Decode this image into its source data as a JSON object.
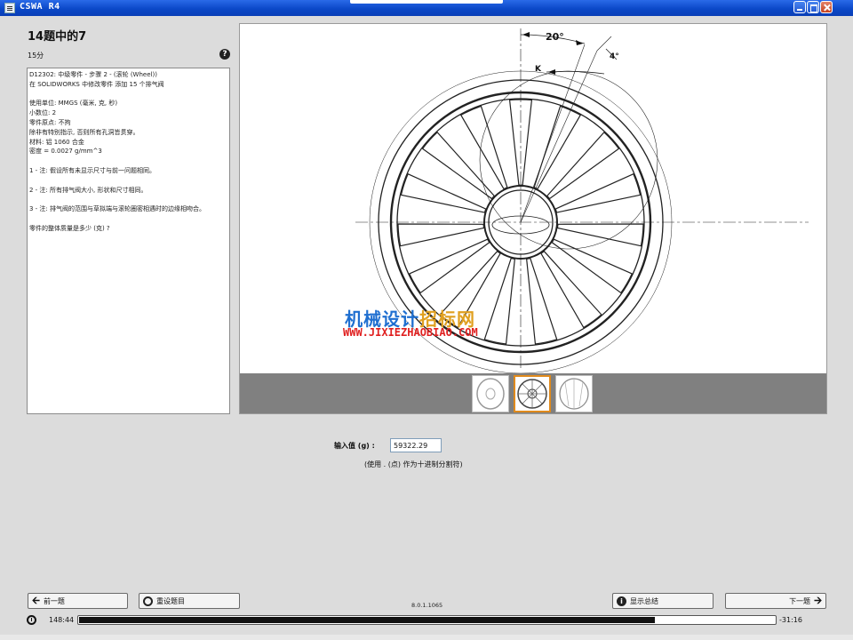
{
  "window": {
    "title": "CSWA R4"
  },
  "question": {
    "header": "14题中的7",
    "points": "15分",
    "help_icon": "question-mark-icon",
    "text": "D12302: 中级零件 - 步骤 2 - (滚轮 (Wheel))\n在 SOLIDWORKS 中修改零件 添加 15 个排气阀\n\n使用单位: MMGS (毫米, 克, 秒)\n小数位: 2\n零件原点: 不拘\n除非有特别指示, 否则所有孔洞皆贯穿。\n材料: 铝 1060 合金\n密度 = 0.0027 g/mm^3\n\n1 - 注: 假设所有未显示尺寸与前一问题相同。\n\n2 - 注: 所有排气阀大小, 形状和尺寸相同。\n\n3 - 注: 排气阀的范围与草拟端与滚轮圈密相遇时的边缘相吻合。\n\n零件的整体质量是多少 (克) ?"
  },
  "drawing": {
    "dimensions": [
      "20°",
      "4°",
      "K"
    ],
    "watermark_cn_a": "机械设计",
    "watermark_cn_b": "招标网",
    "watermark_url": "WWW.JIXIEZHAOBIAO.COM",
    "thumbnails_selected": 2
  },
  "answer": {
    "label": "输入值 (g) :",
    "value": "59322.29",
    "hint": "(使用 . (点) 作为十进制分割符)"
  },
  "buttons": {
    "prev": "前一题",
    "reset": "重设题目",
    "summary": "显示总结",
    "next": "下一题"
  },
  "version": "8.0.1.1065",
  "timer": {
    "elapsed": "148:44",
    "remaining": "-31:16",
    "progress_fraction": 0.827
  },
  "colors": {
    "titlebar": "#0b48c8",
    "selected_thumb": "#e08a1c",
    "watermark_blue": "#1f6fd0",
    "watermark_orange": "#e0a020",
    "watermark_red": "#e02020"
  }
}
